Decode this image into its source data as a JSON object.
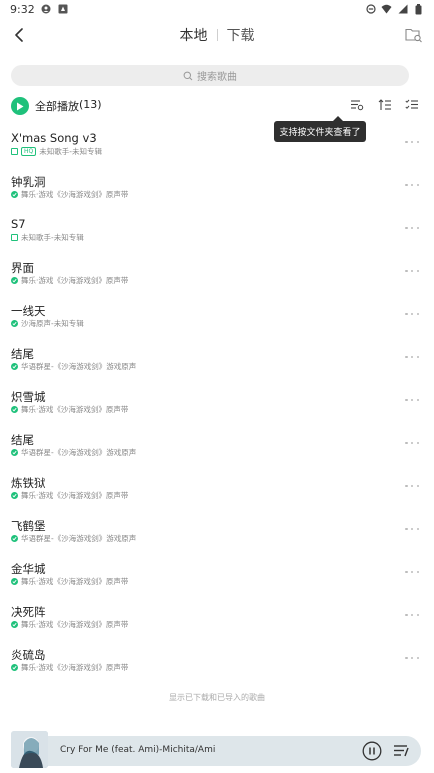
{
  "status": {
    "time": "9:32"
  },
  "header": {
    "tabs": [
      {
        "label": "本地"
      },
      {
        "label": "下载"
      }
    ]
  },
  "search": {
    "placeholder": "搜索歌曲"
  },
  "toolbar": {
    "play_all_label": "全部播放",
    "count": "(13)"
  },
  "tooltip": {
    "text": "支持按文件夹查看了"
  },
  "songs": [
    {
      "title": "X'mas Song v3",
      "subtitle": "未知歌手-未知专辑",
      "status": "local-hq"
    },
    {
      "title": "钟乳洞",
      "subtitle": "舞乐·游戏《沙海游戏剑》原声带",
      "status": "downloaded"
    },
    {
      "title": "S7",
      "subtitle": "未知歌手-未知专辑",
      "status": "local"
    },
    {
      "title": "界面",
      "subtitle": "舞乐·游戏《沙海游戏剑》原声带",
      "status": "downloaded"
    },
    {
      "title": "一线天",
      "subtitle": "沙海原声-未知专辑",
      "status": "downloaded"
    },
    {
      "title": "结尾",
      "subtitle": "华语群星-《沙海游戏剑》游戏原声",
      "status": "downloaded"
    },
    {
      "title": "炽雪城",
      "subtitle": "舞乐·游戏《沙海游戏剑》原声带",
      "status": "downloaded"
    },
    {
      "title": "结尾",
      "subtitle": "华语群星-《沙海游戏剑》游戏原声",
      "status": "downloaded"
    },
    {
      "title": "炼铁狱",
      "subtitle": "舞乐·游戏《沙海游戏剑》原声带",
      "status": "downloaded"
    },
    {
      "title": "飞鹤堡",
      "subtitle": "华语群星-《沙海游戏剑》游戏原声",
      "status": "downloaded"
    },
    {
      "title": "金华城",
      "subtitle": "舞乐·游戏《沙海游戏剑》原声带",
      "status": "downloaded"
    },
    {
      "title": "决死阵",
      "subtitle": "舞乐·游戏《沙海游戏剑》原声带",
      "status": "downloaded"
    },
    {
      "title": "炎硫岛",
      "subtitle": "舞乐·游戏《沙海游戏剑》原声带",
      "status": "downloaded"
    }
  ],
  "footer_note": "显示已下载和已导入的歌曲",
  "player": {
    "now_playing": "Cry For Me (feat. Ami)-Michita/Ami"
  },
  "colors": {
    "accent": "#1fc17b",
    "player_bg": "#dee6ea",
    "tooltip_bg": "#2f2f2f"
  }
}
